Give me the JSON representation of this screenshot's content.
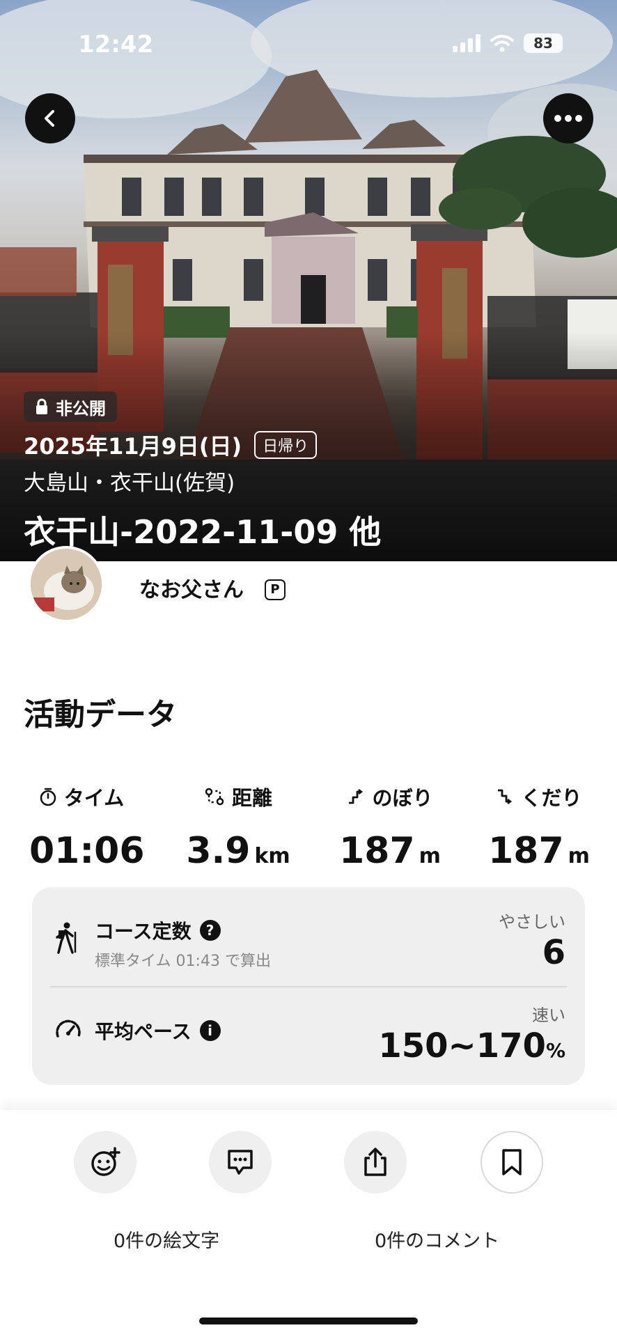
{
  "status_bar": {
    "time": "12:42",
    "battery": "83"
  },
  "hero": {
    "privacy": "非公開",
    "date": "2025年11月9日(日)",
    "trip_type": "日帰り",
    "mountains": "大島山・衣干山(佐賀)",
    "title": "衣干山-2022-11-09 他"
  },
  "user": {
    "name": "なお父さん",
    "badge": "P"
  },
  "activity": {
    "section_title": "活動データ",
    "stats": [
      {
        "label": "タイム",
        "value": "01:06",
        "unit": ""
      },
      {
        "label": "距離",
        "value": "3.9",
        "unit": "km"
      },
      {
        "label": "のぼり",
        "value": "187",
        "unit": "m"
      },
      {
        "label": "くだり",
        "value": "187",
        "unit": "m"
      }
    ],
    "course_constant": {
      "title": "コース定数",
      "help": "?",
      "sub": "標準タイム 01:43 で算出",
      "rating": "やさしい",
      "value": "6"
    },
    "average_pace": {
      "title": "平均ペース",
      "info": "i",
      "rating": "速い",
      "value": "150~170",
      "unit": "%"
    }
  },
  "footer": {
    "emoji_count": "0件の絵文字",
    "comment_count": "0件のコメント"
  }
}
